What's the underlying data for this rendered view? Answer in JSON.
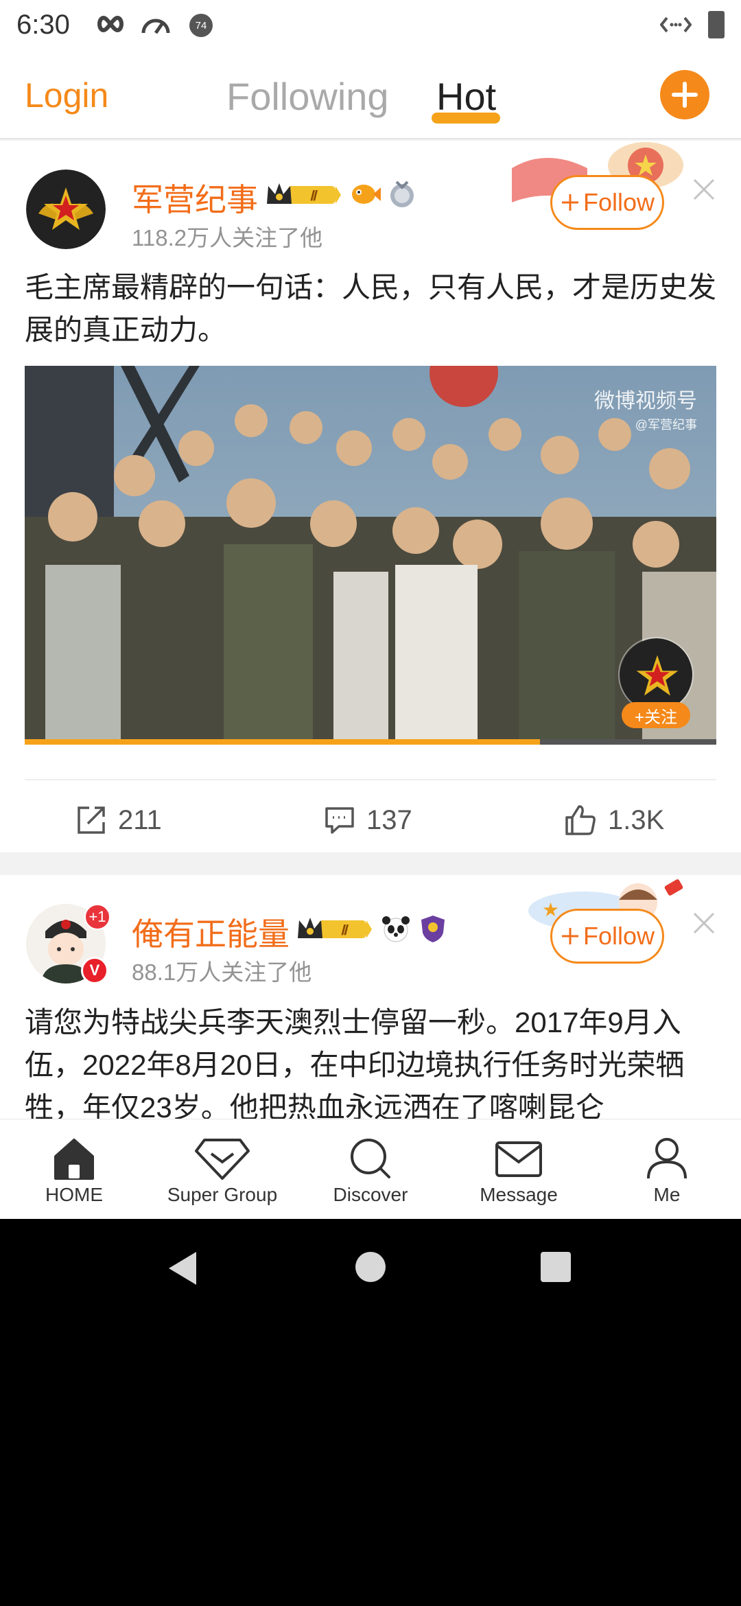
{
  "status_bar": {
    "time": "6:30",
    "notification_badge": "74",
    "icons": [
      "infinity-icon",
      "speedometer-icon",
      "notification-icon",
      "data-transfer-icon",
      "battery-icon"
    ]
  },
  "top_nav": {
    "login": "Login",
    "tabs": [
      {
        "label": "Following",
        "active": false
      },
      {
        "label": "Hot",
        "active": true
      }
    ],
    "add_button_icon": "plus-icon"
  },
  "posts": [
    {
      "username": "军营纪事",
      "level_badge": "Ⅱ",
      "followers": "118.2万人关注了他",
      "follow_label": "Follow",
      "text": "毛主席最精辟的一句话：人民，只有人民，才是历史发展的真正动力。",
      "video": {
        "watermark": "微博视频号",
        "watermark_sub": "@军营纪事",
        "follow_pill": "+关注",
        "progress": 0.745
      },
      "actions": {
        "reposts": "211",
        "comments": "137",
        "likes": "1.3K"
      }
    },
    {
      "username": "俺有正能量",
      "level_badge": "Ⅱ",
      "notification_count": "+1",
      "verified_badge": "V",
      "followers": "88.1万人关注了他",
      "follow_label": "Follow",
      "text": "请您为特战尖兵李天澳烈士停留一秒。2017年9月入伍，2022年8月20日，在中印边境执行任务时光荣牺牲，年仅23岁。他把热血永远洒在了喀喇昆仑"
    }
  ],
  "tab_bar": {
    "tabs": [
      {
        "label": "HOME",
        "icon": "home-icon"
      },
      {
        "label": "Super Group",
        "icon": "diamond-icon"
      },
      {
        "label": "Discover",
        "icon": "search-icon"
      },
      {
        "label": "Message",
        "icon": "envelope-icon"
      },
      {
        "label": "Me",
        "icon": "person-icon"
      }
    ]
  },
  "colors": {
    "accent": "#f5891a",
    "username": "#f26d1a",
    "hot_underline": "#f5a21a"
  }
}
